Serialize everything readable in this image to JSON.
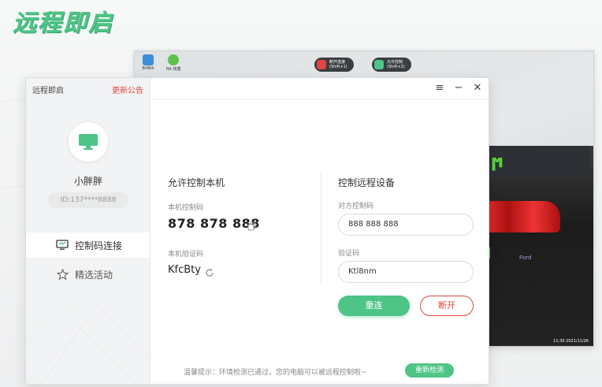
{
  "brand": {
    "title": "远程即启"
  },
  "remote_desktop": {
    "desktop_icons": [
      {
        "label": "BiliBili",
        "icon": "app-icon"
      },
      {
        "label": "HA 快捷",
        "icon": "app-icon"
      }
    ],
    "pills": [
      {
        "title": "断开连接",
        "sub": "(Shift+1)",
        "icon": "disconnect-icon",
        "color": "#e0463e"
      },
      {
        "title": "允许控制",
        "sub": "(Shift+2)",
        "icon": "control-icon",
        "color": "#4ec487"
      }
    ],
    "clock": "11:30",
    "date": "2021/11/26"
  },
  "app": {
    "name": "远程即启",
    "notice_link": "更新公告",
    "user": {
      "name": "小胖胖",
      "id_text": "ID:137****8888"
    },
    "nav": [
      {
        "label": "控制码连接",
        "icon": "monitor-icon",
        "active": true
      },
      {
        "label": "精选活动",
        "icon": "star-icon",
        "active": false
      }
    ],
    "window_controls": {
      "menu": "≡",
      "minimize": "−",
      "close": "✕"
    },
    "local": {
      "title": "允许控制本机",
      "code_label": "本机控制码",
      "code": "878 878 888",
      "verify_label": "本机验证码",
      "verify": "KfcBty"
    },
    "remote": {
      "title": "控制远程设备",
      "code_label": "对方控制码",
      "code_value": "888 888 888",
      "verify_label": "验证码",
      "verify_value": "Ktl8nm",
      "connect_button": "重连",
      "disconnect_button": "断开"
    },
    "footer": {
      "tip": "温馨提示：环境检测已通过，您的电脑可以被远程控制啦~",
      "recheck_button": "重新检测"
    }
  },
  "colors": {
    "accent": "#4ec487",
    "danger": "#e0463e"
  }
}
